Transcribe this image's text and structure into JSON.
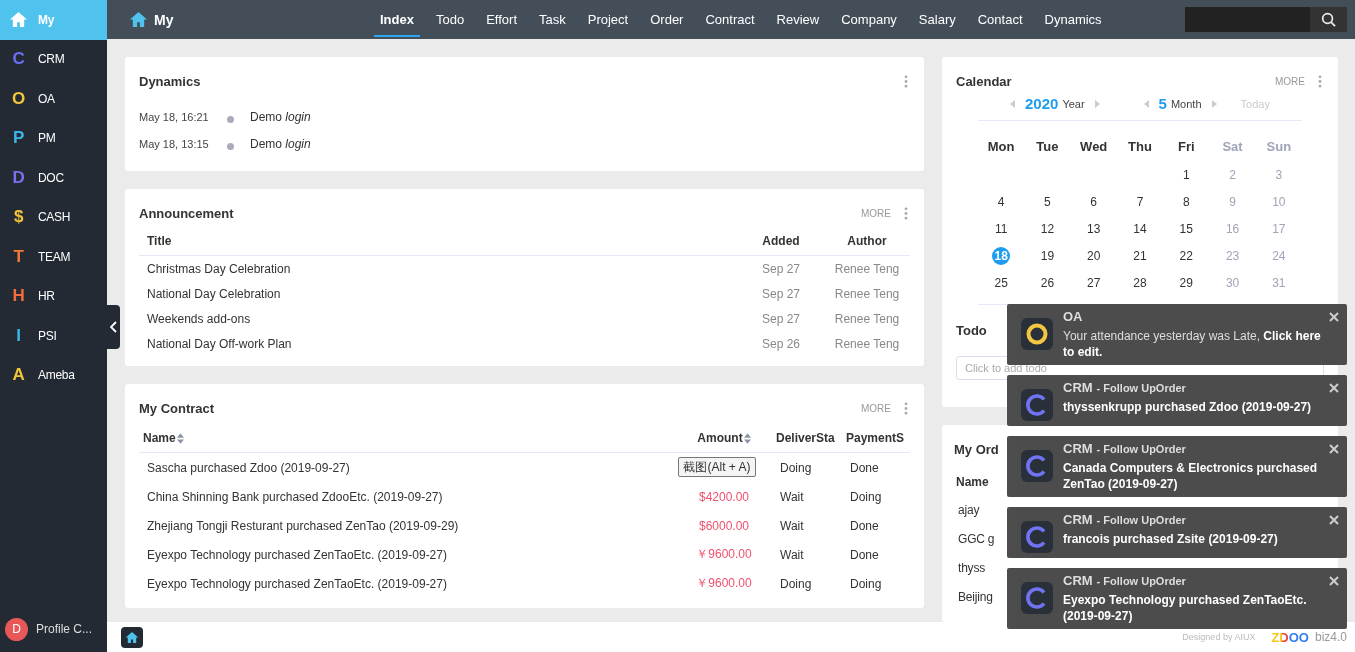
{
  "sidebar": {
    "items": [
      {
        "kind": "home",
        "label": "My",
        "selected": true
      },
      {
        "kind": "letter",
        "icon": "C",
        "color": "#6c6ff2",
        "label": "CRM",
        "selected": false
      },
      {
        "kind": "letter",
        "icon": "O",
        "color": "#f2c53a",
        "label": "OA",
        "selected": false
      },
      {
        "kind": "letter",
        "icon": "P",
        "color": "#3bb6e8",
        "label": "PM",
        "selected": false
      },
      {
        "kind": "letter",
        "icon": "D",
        "color": "#7b6ff2",
        "label": "DOC",
        "selected": false
      },
      {
        "kind": "letter",
        "icon": "$",
        "color": "#f2c53a",
        "label": "CASH",
        "selected": false
      },
      {
        "kind": "letter",
        "icon": "T",
        "color": "#f27b3a",
        "label": "TEAM",
        "selected": false
      },
      {
        "kind": "letter",
        "icon": "H",
        "color": "#f26d3a",
        "label": "HR",
        "selected": false
      },
      {
        "kind": "letter",
        "icon": "I",
        "color": "#3bb6e8",
        "label": "PSI",
        "selected": false
      },
      {
        "kind": "letter",
        "icon": "A",
        "color": "#f2c53a",
        "label": "Ameba",
        "selected": false
      }
    ],
    "profile": {
      "initial": "D",
      "name": "Profile C..."
    }
  },
  "topbar": {
    "title": "My",
    "tabs": [
      {
        "label": "Index",
        "selected": true
      },
      {
        "label": "Todo",
        "selected": false
      },
      {
        "label": "Effort",
        "selected": false
      },
      {
        "label": "Task",
        "selected": false
      },
      {
        "label": "Project",
        "selected": false
      },
      {
        "label": "Order",
        "selected": false
      },
      {
        "label": "Contract",
        "selected": false
      },
      {
        "label": "Review",
        "selected": false
      },
      {
        "label": "Company",
        "selected": false
      },
      {
        "label": "Salary",
        "selected": false
      },
      {
        "label": "Contact",
        "selected": false
      },
      {
        "label": "Dynamics",
        "selected": false
      }
    ]
  },
  "dynamics": {
    "title": "Dynamics",
    "entries": [
      {
        "time": "May 18, 16:21",
        "text": "Demo *login*"
      },
      {
        "time": "May 18, 13:15",
        "text": "Demo *login*"
      }
    ]
  },
  "announcement": {
    "title": "Announcement",
    "more": "MORE",
    "columns": [
      "Title",
      "Added",
      "Author"
    ],
    "rows": [
      [
        "Christmas Day Celebration",
        "Sep 27",
        "Renee Teng"
      ],
      [
        "National Day Celebration",
        "Sep 27",
        "Renee Teng"
      ],
      [
        "Weekends add-ons",
        "Sep 27",
        "Renee Teng"
      ],
      [
        "National Day Off-work Plan",
        "Sep 26",
        "Renee Teng"
      ]
    ]
  },
  "contract": {
    "title": "My Contract",
    "more": "MORE",
    "columns": [
      {
        "label": "Name",
        "sortable": true
      },
      {
        "label": "Amount",
        "sortable": true
      },
      {
        "label": "DeliverSta",
        "sortable": false
      },
      {
        "label": "PaymentS",
        "sortable": false
      }
    ],
    "rows": [
      {
        "name": "Sascha purchased Zdoo (2019-09-27)",
        "deliver": "Doing",
        "payment": "Done"
      },
      {
        "name": "China Shinning Bank purchased ZdooEtc. (2019-09-27)",
        "amount": "$4200.00",
        "deliver": "Wait",
        "payment": "Doing"
      },
      {
        "name": "Zhejiang Tongji Resturant purchased ZenTao (2019-09-29)",
        "amount": "$6000.00",
        "deliver": "Wait",
        "payment": "Done"
      },
      {
        "name": "Eyexpo Technology purchased ZenTaoEtc. (2019-09-27)",
        "amount": "￥9600.00",
        "deliver": "Wait",
        "payment": "Done"
      },
      {
        "name": "Eyexpo Technology purchased ZenTaoEtc. (2019-09-27)",
        "amount": "￥9600.00",
        "deliver": "Doing",
        "payment": "Doing"
      }
    ],
    "tooltip": "截图(Alt + A)"
  },
  "calendar": {
    "title": "Calendar",
    "more": "MORE",
    "year": "2020",
    "year_label": "Year",
    "month": "5",
    "month_label": "Month",
    "today": "Today",
    "weekdays": [
      "Mon",
      "Tue",
      "Wed",
      "Thu",
      "Fri",
      "Sat",
      "Sun"
    ],
    "weeks": [
      [
        {
          "d": "1",
          "selected": false
        },
        {
          "d": "2",
          "selected": false
        },
        {
          "d": "3",
          "selected": false
        }
      ],
      [
        {
          "d": "4",
          "selected": false
        },
        {
          "d": "5",
          "selected": false
        },
        {
          "d": "6",
          "selected": false
        },
        {
          "d": "7",
          "selected": false
        },
        {
          "d": "8",
          "selected": false
        },
        {
          "d": "9",
          "selected": false
        },
        {
          "d": "10",
          "selected": false
        }
      ],
      [
        {
          "d": "11",
          "selected": false
        },
        {
          "d": "12",
          "selected": false
        },
        {
          "d": "13",
          "selected": false
        },
        {
          "d": "14",
          "selected": false
        },
        {
          "d": "15",
          "selected": false
        },
        {
          "d": "16",
          "selected": false
        },
        {
          "d": "17",
          "selected": false
        }
      ],
      [
        {
          "d": "18",
          "selected": true
        },
        {
          "d": "19",
          "selected": false
        },
        {
          "d": "20",
          "selected": false
        },
        {
          "d": "21",
          "selected": false
        },
        {
          "d": "22",
          "selected": false
        },
        {
          "d": "23",
          "selected": false
        },
        {
          "d": "24",
          "selected": false
        }
      ],
      [
        {
          "d": "25",
          "selected": false
        },
        {
          "d": "26",
          "selected": false
        },
        {
          "d": "27",
          "selected": false
        },
        {
          "d": "28",
          "selected": false
        },
        {
          "d": "29",
          "selected": false
        },
        {
          "d": "30",
          "selected": false
        },
        {
          "d": "31",
          "selected": false
        }
      ]
    ],
    "todo_title": "Todo",
    "todo_placeholder": "Click to add todo"
  },
  "order": {
    "title": "My Ord",
    "name_column": "Name",
    "rows": [
      "ajay",
      "GGC g",
      "thyss",
      "Beijing"
    ]
  },
  "notifications": [
    {
      "kind": "oa",
      "app": "OA",
      "message": "Your attendance yesterday was Late, **Click here to edit.**"
    },
    {
      "kind": "crm",
      "app": "CRM",
      "subtitle": "- Follow UpOrder",
      "message": "thyssenkrupp purchased Zdoo (2019-09-27)"
    },
    {
      "kind": "crm",
      "app": "CRM",
      "subtitle": "- Follow UpOrder",
      "message": "Canada Computers & Electronics purchased ZenTao (2019-09-27)"
    },
    {
      "kind": "crm",
      "app": "CRM",
      "subtitle": "- Follow UpOrder",
      "message": "francois purchased Zsite (2019-09-27)"
    },
    {
      "kind": "crm",
      "app": "CRM",
      "subtitle": "- Follow UpOrder",
      "message": "Eyexpo Technology purchased ZenTaoEtc. (2019-09-27)"
    }
  ],
  "footer": {
    "designed": "Designed by AIUX",
    "logo": "ZDOO",
    "version": "biz4.0"
  }
}
